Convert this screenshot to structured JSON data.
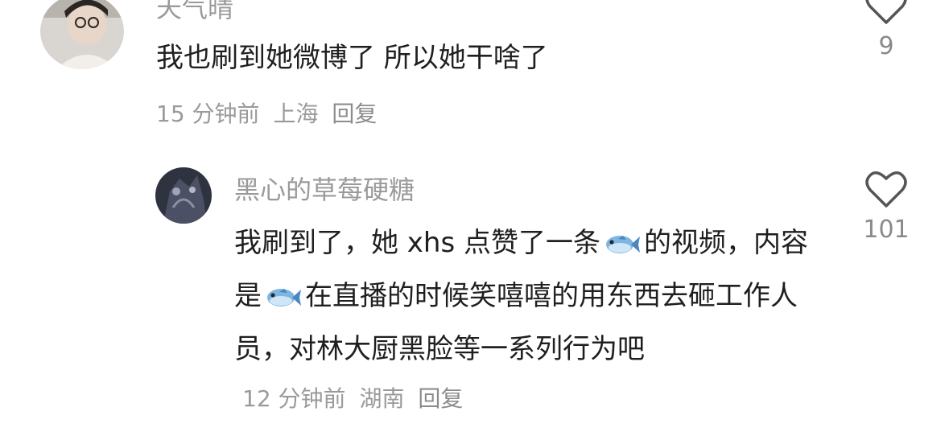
{
  "comments": [
    {
      "username": "天气晴",
      "text": "我也刷到她微博了 所以她干啥了",
      "time": "15 分钟前",
      "location": "上海",
      "reply_label": "回复",
      "likes": "9"
    },
    {
      "username": "黑心的草莓硬糖",
      "text_parts": [
        "我刷到了，她 xhs 点赞了一条",
        "的视频，内容是",
        "在直播的时候笑嘻嘻的用东西去砸工作人员，对林大厨黑脸等一系列行为吧"
      ],
      "fish_emoji": "🐟",
      "time": "12 分钟前",
      "location": "湖南",
      "reply_label": "回复",
      "likes": "101"
    }
  ],
  "icons": {
    "like": "heart-outline-icon",
    "fish": "fish-emoji-icon"
  },
  "colors": {
    "username": "#9a9a9a",
    "text": "#1f1f1f",
    "meta": "#9a9a9a",
    "heart_stroke": "#555555"
  }
}
